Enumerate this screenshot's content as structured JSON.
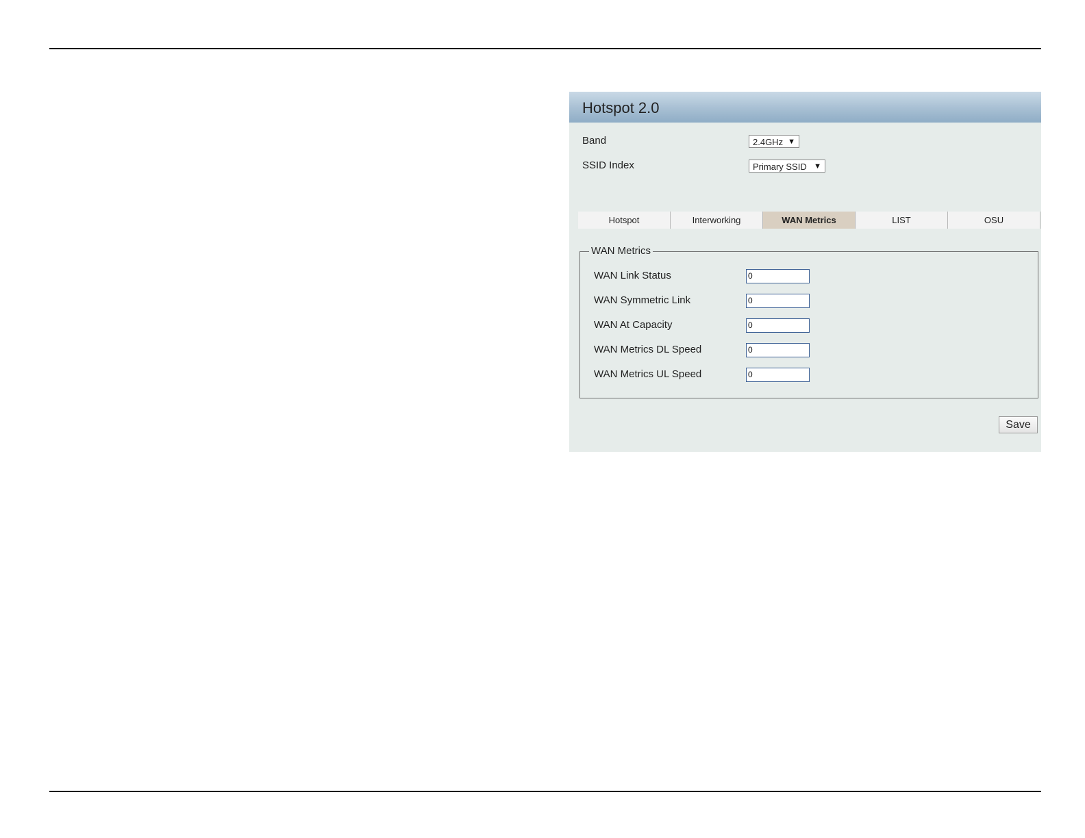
{
  "panel": {
    "title": "Hotspot 2.0",
    "band_label": "Band",
    "band_value": "2.4GHz",
    "ssid_label": "SSID Index",
    "ssid_value": "Primary SSID"
  },
  "tabs": [
    {
      "label": "Hotspot",
      "active": false
    },
    {
      "label": "Interworking",
      "active": false
    },
    {
      "label": "WAN Metrics",
      "active": true
    },
    {
      "label": "LIST",
      "active": false
    },
    {
      "label": "OSU",
      "active": false
    }
  ],
  "wan_metrics": {
    "legend": "WAN Metrics",
    "fields": [
      {
        "label": "WAN Link Status",
        "value": "0"
      },
      {
        "label": "WAN Symmetric Link",
        "value": "0"
      },
      {
        "label": "WAN At Capacity",
        "value": "0"
      },
      {
        "label": "WAN Metrics DL Speed",
        "value": "0"
      },
      {
        "label": "WAN Metrics UL Speed",
        "value": "0"
      }
    ]
  },
  "buttons": {
    "save_label": "Save"
  },
  "icons": {
    "dropdown_arrow": "▼"
  },
  "colors": {
    "panel_bg": "#e6ecea",
    "header_gradient_end": "#8fadc6",
    "active_tab": "#d9cfc1",
    "input_border": "#3b5f94"
  }
}
